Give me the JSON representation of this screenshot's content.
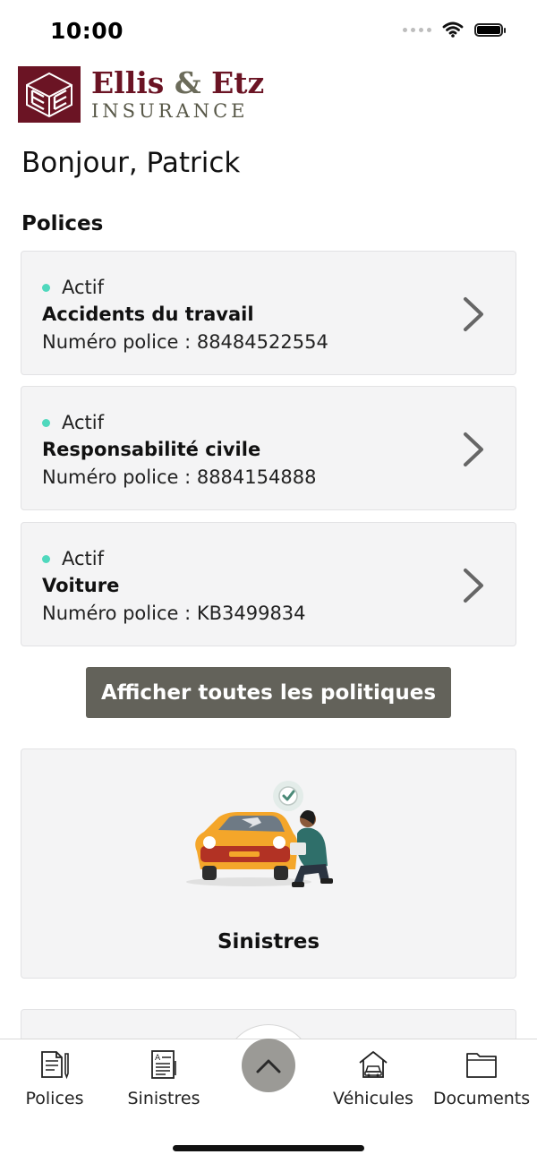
{
  "status_bar": {
    "time": "10:00"
  },
  "brand": {
    "name_part1": "Ellis",
    "name_amp": "&",
    "name_part2": "Etz",
    "subtitle": "INSURANCE"
  },
  "greeting": "Bonjour, Patrick",
  "policies_section": {
    "title": "Polices",
    "items": [
      {
        "status": "Actif",
        "name": "Accidents du travail",
        "number_label": "Numéro police : 88484522554"
      },
      {
        "status": "Actif",
        "name": "Responsabilité civile",
        "number_label": "Numéro police : 8884154888"
      },
      {
        "status": "Actif",
        "name": "Voiture",
        "number_label": "Numéro police : KB3499834"
      }
    ],
    "view_all_label": "Afficher toutes les politiques"
  },
  "claims_card": {
    "label": "Sinistres"
  },
  "tab_bar": {
    "tabs": [
      {
        "label": "Polices",
        "icon": "policy-document-icon"
      },
      {
        "label": "Sinistres",
        "icon": "claims-document-icon"
      },
      {
        "label": "",
        "icon": "chevron-up-icon"
      },
      {
        "label": "Véhicules",
        "icon": "house-car-icon"
      },
      {
        "label": "Documents",
        "icon": "folder-icon"
      }
    ]
  },
  "colors": {
    "brand": "#6b1424",
    "status_active": "#4fd8bd",
    "button_bg": "#63625a",
    "card_bg": "#f4f4f5"
  }
}
